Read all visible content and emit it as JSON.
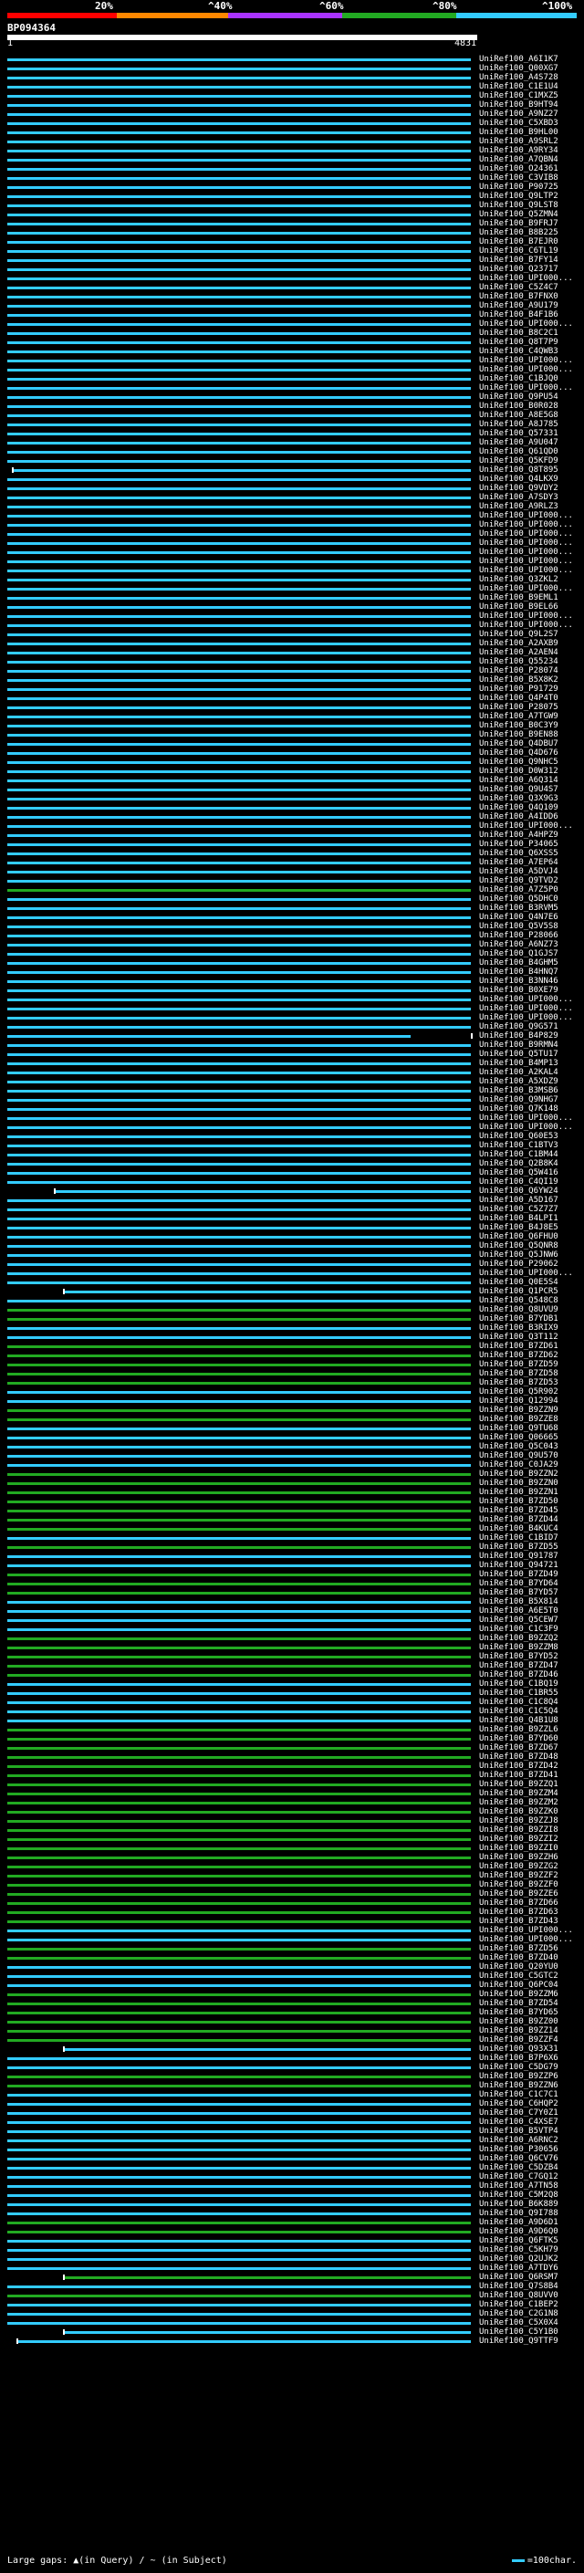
{
  "scale": {
    "labels": [
      "20%",
      "^40%",
      "^60%",
      "^80%",
      "^100%"
    ],
    "colors": [
      "#ff0000",
      "#ff8800",
      "#aa33ff",
      "#22aa22",
      "#33ccff"
    ]
  },
  "query": {
    "id": "BP094364",
    "start_label": "1",
    "end_label": "4831"
  },
  "hits": [
    {
      "name": "UniRef100_A6I1K7",
      "color": "#33ccff"
    },
    {
      "name": "UniRef100_Q00XG7",
      "color": "#33ccff"
    },
    {
      "name": "UniRef100_A4S728",
      "color": "#33ccff"
    },
    {
      "name": "UniRef100_C1E1U4",
      "color": "#33ccff"
    },
    {
      "name": "UniRef100_C1MXZ5",
      "color": "#33ccff"
    },
    {
      "name": "UniRef100_B9HT94",
      "color": "#33ccff"
    },
    {
      "name": "UniRef100_A9NZ27",
      "color": "#33ccff"
    },
    {
      "name": "UniRef100_C5XBD3",
      "color": "#33ccff"
    },
    {
      "name": "UniRef100_B9HL00",
      "color": "#33ccff"
    },
    {
      "name": "UniRef100_A9SRL2",
      "color": "#33ccff"
    },
    {
      "name": "UniRef100_A9RY34",
      "color": "#33ccff"
    },
    {
      "name": "UniRef100_A7QBN4",
      "color": "#33ccff"
    },
    {
      "name": "UniRef100_O24361",
      "color": "#33ccff"
    },
    {
      "name": "UniRef100_C3VIB8",
      "color": "#33ccff"
    },
    {
      "name": "UniRef100_P90725",
      "color": "#33ccff"
    },
    {
      "name": "UniRef100_Q9LTP2",
      "color": "#33ccff"
    },
    {
      "name": "UniRef100_Q9LST8",
      "color": "#33ccff"
    },
    {
      "name": "UniRef100_Q5ZMN4",
      "color": "#33ccff"
    },
    {
      "name": "UniRef100_B9FRJ7",
      "color": "#33ccff"
    },
    {
      "name": "UniRef100_B8B225",
      "color": "#33ccff"
    },
    {
      "name": "UniRef100_B7EJR0",
      "color": "#33ccff"
    },
    {
      "name": "UniRef100_C6TL19",
      "color": "#33ccff"
    },
    {
      "name": "UniRef100_B7FY14",
      "color": "#33ccff"
    },
    {
      "name": "UniRef100_Q23717",
      "color": "#33ccff"
    },
    {
      "name": "UniRef100_UPI000...",
      "color": "#33ccff"
    },
    {
      "name": "UniRef100_C5Z4C7",
      "color": "#33ccff"
    },
    {
      "name": "UniRef100_B7FNX0",
      "color": "#33ccff"
    },
    {
      "name": "UniRef100_A9U179",
      "color": "#33ccff"
    },
    {
      "name": "UniRef100_B4F1B6",
      "color": "#33ccff"
    },
    {
      "name": "UniRef100_UPI000...",
      "color": "#33ccff"
    },
    {
      "name": "UniRef100_B8C2C1",
      "color": "#33ccff"
    },
    {
      "name": "UniRef100_Q8T7P9",
      "color": "#33ccff"
    },
    {
      "name": "UniRef100_C4QWB3",
      "color": "#33ccff"
    },
    {
      "name": "UniRef100_UPI000...",
      "color": "#33ccff"
    },
    {
      "name": "UniRef100_UPI000...",
      "color": "#33ccff"
    },
    {
      "name": "UniRef100_C1BJQ0",
      "color": "#33ccff"
    },
    {
      "name": "UniRef100_UPI000...",
      "color": "#33ccff"
    },
    {
      "name": "UniRef100_Q9PU54",
      "color": "#33ccff"
    },
    {
      "name": "UniRef100_B0R028",
      "color": "#33ccff"
    },
    {
      "name": "UniRef100_A8E5G8",
      "color": "#33ccff"
    },
    {
      "name": "UniRef100_A8J785",
      "color": "#33ccff"
    },
    {
      "name": "UniRef100_Q57331",
      "color": "#33ccff"
    },
    {
      "name": "UniRef100_A9U047",
      "color": "#33ccff"
    },
    {
      "name": "UniRef100_Q61QD0",
      "color": "#33ccff"
    },
    {
      "name": "UniRef100_Q5KFD9",
      "color": "#33ccff"
    },
    {
      "name": "UniRef100_Q8T895",
      "color": "#33ccff",
      "gap": [
        0.0,
        0.01
      ]
    },
    {
      "name": "UniRef100_Q4LKX9",
      "color": "#33ccff"
    },
    {
      "name": "UniRef100_Q9VDY2",
      "color": "#33ccff"
    },
    {
      "name": "UniRef100_A7SDY3",
      "color": "#33ccff"
    },
    {
      "name": "UniRef100_A9RLZ3",
      "color": "#33ccff"
    },
    {
      "name": "UniRef100_UPI000...",
      "color": "#33ccff"
    },
    {
      "name": "UniRef100_UPI000...",
      "color": "#33ccff"
    },
    {
      "name": "UniRef100_UPI000...",
      "color": "#33ccff"
    },
    {
      "name": "UniRef100_UPI000...",
      "color": "#33ccff"
    },
    {
      "name": "UniRef100_UPI000...",
      "color": "#33ccff"
    },
    {
      "name": "UniRef100_UPI000...",
      "color": "#33ccff"
    },
    {
      "name": "UniRef100_UPI000...",
      "color": "#33ccff"
    },
    {
      "name": "UniRef100_Q3ZKL2",
      "color": "#33ccff"
    },
    {
      "name": "UniRef100_UPI000...",
      "color": "#33ccff"
    },
    {
      "name": "UniRef100_B9EML1",
      "color": "#33ccff"
    },
    {
      "name": "UniRef100_B9EL66",
      "color": "#33ccff"
    },
    {
      "name": "UniRef100_UPI000...",
      "color": "#33ccff"
    },
    {
      "name": "UniRef100_UPI000...",
      "color": "#33ccff"
    },
    {
      "name": "UniRef100_Q9L2S7",
      "color": "#33ccff"
    },
    {
      "name": "UniRef100_A2AXB9",
      "color": "#33ccff"
    },
    {
      "name": "UniRef100_A2AEN4",
      "color": "#33ccff"
    },
    {
      "name": "UniRef100_Q55234",
      "color": "#33ccff"
    },
    {
      "name": "UniRef100_P28074",
      "color": "#33ccff"
    },
    {
      "name": "UniRef100_B5X8K2",
      "color": "#33ccff"
    },
    {
      "name": "UniRef100_P91729",
      "color": "#33ccff"
    },
    {
      "name": "UniRef100_Q4P4T0",
      "color": "#33ccff"
    },
    {
      "name": "UniRef100_P28075",
      "color": "#33ccff"
    },
    {
      "name": "UniRef100_A7TGW9",
      "color": "#33ccff"
    },
    {
      "name": "UniRef100_B0C3Y9",
      "color": "#33ccff"
    },
    {
      "name": "UniRef100_B9EN88",
      "color": "#33ccff"
    },
    {
      "name": "UniRef100_Q4DBU7",
      "color": "#33ccff"
    },
    {
      "name": "UniRef100_Q4D676",
      "color": "#33ccff"
    },
    {
      "name": "UniRef100_Q9NHC5",
      "color": "#33ccff"
    },
    {
      "name": "UniRef100_D0W312",
      "color": "#33ccff"
    },
    {
      "name": "UniRef100_A6Q314",
      "color": "#33ccff"
    },
    {
      "name": "UniRef100_Q9U4S7",
      "color": "#33ccff"
    },
    {
      "name": "UniRef100_Q3X9G3",
      "color": "#33ccff"
    },
    {
      "name": "UniRef100_Q4Q109",
      "color": "#33ccff"
    },
    {
      "name": "UniRef100_A4IDD6",
      "color": "#33ccff"
    },
    {
      "name": "UniRef100_UPI000...",
      "color": "#33ccff"
    },
    {
      "name": "UniRef100_A4HPZ9",
      "color": "#33ccff"
    },
    {
      "name": "UniRef100_P34065",
      "color": "#33ccff"
    },
    {
      "name": "UniRef100_Q6XSS5",
      "color": "#33ccff"
    },
    {
      "name": "UniRef100_A7EP64",
      "color": "#33ccff"
    },
    {
      "name": "UniRef100_A5DVJ4",
      "color": "#33ccff"
    },
    {
      "name": "UniRef100_Q9TVD2",
      "color": "#33ccff"
    },
    {
      "name": "UniRef100_A7Z5P0",
      "color": "#22aa22"
    },
    {
      "name": "UniRef100_Q5DHC0",
      "color": "#33ccff"
    },
    {
      "name": "UniRef100_B3RVM5",
      "color": "#33ccff"
    },
    {
      "name": "UniRef100_Q4N7E6",
      "color": "#33ccff"
    },
    {
      "name": "UniRef100_Q5V5S8",
      "color": "#33ccff"
    },
    {
      "name": "UniRef100_P28066",
      "color": "#33ccff"
    },
    {
      "name": "UniRef100_A6NZ73",
      "color": "#33ccff"
    },
    {
      "name": "UniRef100_Q1GJS7",
      "color": "#33ccff"
    },
    {
      "name": "UniRef100_B4GHM5",
      "color": "#33ccff"
    },
    {
      "name": "UniRef100_B4HNQ7",
      "color": "#33ccff"
    },
    {
      "name": "UniRef100_B3NN46",
      "color": "#33ccff"
    },
    {
      "name": "UniRef100_B0XE79",
      "color": "#33ccff"
    },
    {
      "name": "UniRef100_UPI000...",
      "color": "#33ccff"
    },
    {
      "name": "UniRef100_UPI000...",
      "color": "#33ccff"
    },
    {
      "name": "UniRef100_UPI000...",
      "color": "#33ccff"
    },
    {
      "name": "UniRef100_Q9G571",
      "color": "#33ccff"
    },
    {
      "name": "UniRef100_B4P829",
      "color": "#33ccff",
      "gap": [
        0.87,
        1.0
      ]
    },
    {
      "name": "UniRef100_B9RMN4",
      "color": "#33ccff"
    },
    {
      "name": "UniRef100_Q5TU17",
      "color": "#33ccff"
    },
    {
      "name": "UniRef100_B4MP13",
      "color": "#33ccff"
    },
    {
      "name": "UniRef100_A2KAL4",
      "color": "#33ccff"
    },
    {
      "name": "UniRef100_A5XDZ9",
      "color": "#33ccff"
    },
    {
      "name": "UniRef100_B3MSB6",
      "color": "#33ccff"
    },
    {
      "name": "UniRef100_Q9NHG7",
      "color": "#33ccff"
    },
    {
      "name": "UniRef100_Q7K148",
      "color": "#33ccff"
    },
    {
      "name": "UniRef100_UPI000...",
      "color": "#33ccff"
    },
    {
      "name": "UniRef100_UPI000...",
      "color": "#33ccff"
    },
    {
      "name": "UniRef100_Q60E53",
      "color": "#33ccff"
    },
    {
      "name": "UniRef100_C1BTV3",
      "color": "#33ccff"
    },
    {
      "name": "UniRef100_C1BM44",
      "color": "#33ccff"
    },
    {
      "name": "UniRef100_Q2B8K4",
      "color": "#33ccff"
    },
    {
      "name": "UniRef100_Q5W416",
      "color": "#33ccff"
    },
    {
      "name": "UniRef100_C4QI19",
      "color": "#33ccff"
    },
    {
      "name": "UniRef100_Q6YW24",
      "color": "#33ccff",
      "gap": [
        0.0,
        0.1
      ]
    },
    {
      "name": "UniRef100_A5D167",
      "color": "#33ccff"
    },
    {
      "name": "UniRef100_C5Z7Z7",
      "color": "#33ccff"
    },
    {
      "name": "UniRef100_B4LPI1",
      "color": "#33ccff"
    },
    {
      "name": "UniRef100_B4J8E5",
      "color": "#33ccff"
    },
    {
      "name": "UniRef100_Q6FHU0",
      "color": "#33ccff"
    },
    {
      "name": "UniRef100_Q5QNR8",
      "color": "#33ccff"
    },
    {
      "name": "UniRef100_Q5JNW6",
      "color": "#33ccff"
    },
    {
      "name": "UniRef100_P29062",
      "color": "#33ccff"
    },
    {
      "name": "UniRef100_UPI000...",
      "color": "#33ccff"
    },
    {
      "name": "UniRef100_Q0E5S4",
      "color": "#33ccff"
    },
    {
      "name": "UniRef100_Q1PCR5",
      "color": "#33ccff",
      "gap": [
        0.0,
        0.12
      ]
    },
    {
      "name": "UniRef100_Q548C8",
      "color": "#33ccff"
    },
    {
      "name": "UniRef100_Q8UVU9",
      "color": "#22aa22"
    },
    {
      "name": "UniRef100_B7YDB1",
      "color": "#22aa22"
    },
    {
      "name": "UniRef100_B3RIX9",
      "color": "#33ccff"
    },
    {
      "name": "UniRef100_Q3T112",
      "color": "#33ccff"
    },
    {
      "name": "UniRef100_B7ZD61",
      "color": "#22aa22"
    },
    {
      "name": "UniRef100_B7ZD62",
      "color": "#22aa22"
    },
    {
      "name": "UniRef100_B7ZD59",
      "color": "#22aa22"
    },
    {
      "name": "UniRef100_B7ZD58",
      "color": "#22aa22"
    },
    {
      "name": "UniRef100_B7ZD53",
      "color": "#22aa22"
    },
    {
      "name": "UniRef100_Q5R902",
      "color": "#33ccff"
    },
    {
      "name": "UniRef100_Q12994",
      "color": "#33ccff"
    },
    {
      "name": "UniRef100_B9ZZN9",
      "color": "#22aa22"
    },
    {
      "name": "UniRef100_B9ZZE8",
      "color": "#22aa22"
    },
    {
      "name": "UniRef100_Q9TU68",
      "color": "#33ccff"
    },
    {
      "name": "UniRef100_Q06665",
      "color": "#33ccff"
    },
    {
      "name": "UniRef100_Q5C043",
      "color": "#33ccff"
    },
    {
      "name": "UniRef100_Q9U570",
      "color": "#33ccff"
    },
    {
      "name": "UniRef100_C0JA29",
      "color": "#33ccff"
    },
    {
      "name": "UniRef100_B9ZZN2",
      "color": "#22aa22"
    },
    {
      "name": "UniRef100_B9ZZN0",
      "color": "#22aa22"
    },
    {
      "name": "UniRef100_B9ZZN1",
      "color": "#22aa22"
    },
    {
      "name": "UniRef100_B7ZD50",
      "color": "#22aa22"
    },
    {
      "name": "UniRef100_B7ZD45",
      "color": "#22aa22"
    },
    {
      "name": "UniRef100_B7ZD44",
      "color": "#22aa22"
    },
    {
      "name": "UniRef100_B4KUC4",
      "color": "#22aa22"
    },
    {
      "name": "UniRef100_C1BID7",
      "color": "#33ccff"
    },
    {
      "name": "UniRef100_B7ZD55",
      "color": "#22aa22"
    },
    {
      "name": "UniRef100_Q91787",
      "color": "#33ccff"
    },
    {
      "name": "UniRef100_Q94721",
      "color": "#33ccff"
    },
    {
      "name": "UniRef100_B7ZD49",
      "color": "#22aa22"
    },
    {
      "name": "UniRef100_B7YD64",
      "color": "#22aa22"
    },
    {
      "name": "UniRef100_B7YD57",
      "color": "#22aa22"
    },
    {
      "name": "UniRef100_B5X814",
      "color": "#33ccff"
    },
    {
      "name": "UniRef100_A6E5T0",
      "color": "#33ccff"
    },
    {
      "name": "UniRef100_Q5CEW7",
      "color": "#33ccff"
    },
    {
      "name": "UniRef100_C1C3F9",
      "color": "#33ccff"
    },
    {
      "name": "UniRef100_B9ZZQ2",
      "color": "#22aa22"
    },
    {
      "name": "UniRef100_B9ZZM8",
      "color": "#22aa22"
    },
    {
      "name": "UniRef100_B7YD52",
      "color": "#22aa22"
    },
    {
      "name": "UniRef100_B7ZD47",
      "color": "#22aa22"
    },
    {
      "name": "UniRef100_B7ZD46",
      "color": "#22aa22"
    },
    {
      "name": "UniRef100_C1BQ19",
      "color": "#33ccff"
    },
    {
      "name": "UniRef100_C1BR55",
      "color": "#33ccff"
    },
    {
      "name": "UniRef100_C1C8Q4",
      "color": "#33ccff"
    },
    {
      "name": "UniRef100_C1C5Q4",
      "color": "#33ccff"
    },
    {
      "name": "UniRef100_Q4B1U8",
      "color": "#33ccff"
    },
    {
      "name": "UniRef100_B9ZZL6",
      "color": "#22aa22"
    },
    {
      "name": "UniRef100_B7YD60",
      "color": "#22aa22"
    },
    {
      "name": "UniRef100_B7ZD67",
      "color": "#22aa22"
    },
    {
      "name": "UniRef100_B7ZD48",
      "color": "#22aa22"
    },
    {
      "name": "UniRef100_B7ZD42",
      "color": "#22aa22"
    },
    {
      "name": "UniRef100_B7ZD41",
      "color": "#22aa22"
    },
    {
      "name": "UniRef100_B9ZZQ1",
      "color": "#22aa22"
    },
    {
      "name": "UniRef100_B9ZZM4",
      "color": "#22aa22"
    },
    {
      "name": "UniRef100_B9ZZM2",
      "color": "#22aa22"
    },
    {
      "name": "UniRef100_B9ZZK0",
      "color": "#22aa22"
    },
    {
      "name": "UniRef100_B9ZZJ8",
      "color": "#22aa22"
    },
    {
      "name": "UniRef100_B9ZZI8",
      "color": "#22aa22"
    },
    {
      "name": "UniRef100_B9ZZI2",
      "color": "#22aa22"
    },
    {
      "name": "UniRef100_B9ZZI0",
      "color": "#22aa22"
    },
    {
      "name": "UniRef100_B9ZZH6",
      "color": "#22aa22"
    },
    {
      "name": "UniRef100_B9ZZG2",
      "color": "#22aa22"
    },
    {
      "name": "UniRef100_B9ZZF2",
      "color": "#22aa22"
    },
    {
      "name": "UniRef100_B9ZZF0",
      "color": "#22aa22"
    },
    {
      "name": "UniRef100_B9ZZE6",
      "color": "#22aa22"
    },
    {
      "name": "UniRef100_B7ZD66",
      "color": "#22aa22"
    },
    {
      "name": "UniRef100_B7ZD63",
      "color": "#22aa22"
    },
    {
      "name": "UniRef100_B7ZD43",
      "color": "#22aa22"
    },
    {
      "name": "UniRef100_UPI000...",
      "color": "#33ccff"
    },
    {
      "name": "UniRef100_UPI000...",
      "color": "#33ccff"
    },
    {
      "name": "UniRef100_B7ZD56",
      "color": "#22aa22"
    },
    {
      "name": "UniRef100_B7ZD40",
      "color": "#22aa22"
    },
    {
      "name": "UniRef100_Q20YU0",
      "color": "#33ccff"
    },
    {
      "name": "UniRef100_C5GTC2",
      "color": "#33ccff"
    },
    {
      "name": "UniRef100_Q6PC04",
      "color": "#33ccff"
    },
    {
      "name": "UniRef100_B9ZZM6",
      "color": "#22aa22"
    },
    {
      "name": "UniRef100_B7ZD54",
      "color": "#22aa22"
    },
    {
      "name": "UniRef100_B7YD65",
      "color": "#22aa22"
    },
    {
      "name": "UniRef100_B9ZZ00",
      "color": "#22aa22"
    },
    {
      "name": "UniRef100_B9ZZ14",
      "color": "#22aa22"
    },
    {
      "name": "UniRef100_B9ZZF4",
      "color": "#22aa22"
    },
    {
      "name": "UniRef100_Q93X31",
      "color": "#33ccff",
      "gap": [
        0.0,
        0.12
      ]
    },
    {
      "name": "UniRef100_B7P6X6",
      "color": "#33ccff"
    },
    {
      "name": "UniRef100_C5DG79",
      "color": "#33ccff"
    },
    {
      "name": "UniRef100_B9ZZP6",
      "color": "#22aa22"
    },
    {
      "name": "UniRef100_B9ZZN6",
      "color": "#22aa22"
    },
    {
      "name": "UniRef100_C1C7C1",
      "color": "#33ccff"
    },
    {
      "name": "UniRef100_C6HQP2",
      "color": "#33ccff"
    },
    {
      "name": "UniRef100_C7Y0Z1",
      "color": "#33ccff"
    },
    {
      "name": "UniRef100_C4XSE7",
      "color": "#33ccff"
    },
    {
      "name": "UniRef100_B5VTP4",
      "color": "#33ccff"
    },
    {
      "name": "UniRef100_A6RNC2",
      "color": "#33ccff"
    },
    {
      "name": "UniRef100_P30656",
      "color": "#33ccff"
    },
    {
      "name": "UniRef100_Q6CV76",
      "color": "#33ccff"
    },
    {
      "name": "UniRef100_C5DZB4",
      "color": "#33ccff"
    },
    {
      "name": "UniRef100_C7GQ12",
      "color": "#33ccff"
    },
    {
      "name": "UniRef100_A7TN58",
      "color": "#33ccff"
    },
    {
      "name": "UniRef100_C5M2Q8",
      "color": "#33ccff"
    },
    {
      "name": "UniRef100_B6K889",
      "color": "#33ccff"
    },
    {
      "name": "UniRef100_Q9I788",
      "color": "#33ccff"
    },
    {
      "name": "UniRef100_A9D6D1",
      "color": "#22aa22"
    },
    {
      "name": "UniRef100_A9D6Q0",
      "color": "#22aa22"
    },
    {
      "name": "UniRef100_Q6FTK5",
      "color": "#33ccff"
    },
    {
      "name": "UniRef100_C5KH79",
      "color": "#33ccff"
    },
    {
      "name": "UniRef100_Q2UJK2",
      "color": "#33ccff"
    },
    {
      "name": "UniRef100_A7TDY6",
      "color": "#33ccff"
    },
    {
      "name": "UniRef100_Q6RSM7",
      "color": "#22aa22",
      "gap": [
        0.0,
        0.12
      ]
    },
    {
      "name": "UniRef100_Q7S8B4",
      "color": "#33ccff"
    },
    {
      "name": "UniRef100_Q8UVV0",
      "color": "#22aa22"
    },
    {
      "name": "UniRef100_C1BEP2",
      "color": "#33ccff"
    },
    {
      "name": "UniRef100_C2G1N8",
      "color": "#33ccff"
    },
    {
      "name": "UniRef100_C5X0X4",
      "color": "#33ccff"
    },
    {
      "name": "UniRef100_C5Y1B0",
      "color": "#33ccff",
      "gap": [
        0.0,
        0.12
      ]
    },
    {
      "name": "UniRef100_Q9TTF9",
      "color": "#33ccff",
      "gap": [
        0.0,
        0.02
      ]
    }
  ],
  "legend": {
    "gaps_text": "Large gaps: ▲(in Query) / ~ (in Subject)",
    "scale_text": "=100char."
  }
}
